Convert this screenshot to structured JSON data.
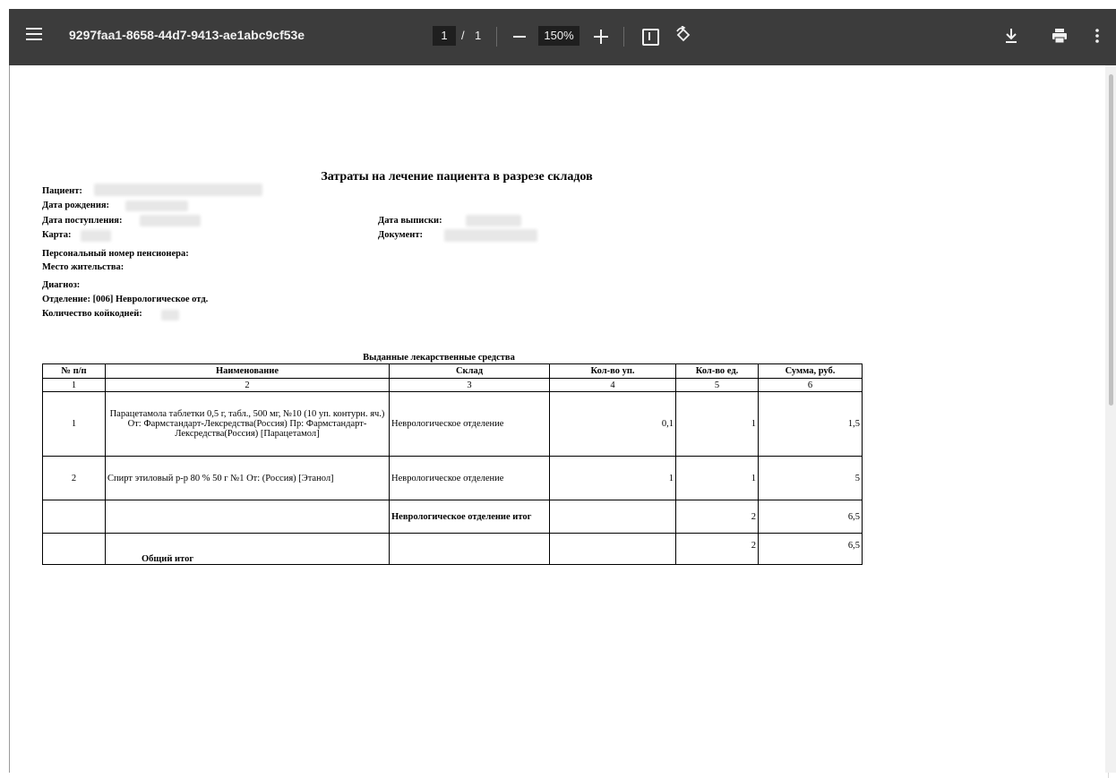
{
  "viewer": {
    "title": "9297faa1-8658-44d7-9413-ae1abc9cf53e",
    "current_page": "1",
    "page_separator": "/",
    "total_pages": "1",
    "zoom": "150%",
    "icons": {
      "menu": "menu-icon",
      "zoom_out": "minus-icon",
      "zoom_in": "plus-icon",
      "fit": "fit-page-icon",
      "rotate": "rotate-icon",
      "download": "download-icon",
      "print": "print-icon",
      "more": "more-vert-icon"
    },
    "colors": {
      "toolbar": "#3c3c3c",
      "toolbar_text": "#f1f1f1",
      "input_bg": "#1f1f1f"
    }
  },
  "document": {
    "title": "Затраты на лечение пациента в разрезе складов",
    "fields": {
      "patient": "Пациент:",
      "birth_date": "Дата рождения:",
      "admission_date": "Дата поступления:",
      "discharge_date": "Дата выписки:",
      "card": "Карта:",
      "document": "Документ:",
      "pension_number": "Персональный номер пенсионера:",
      "residence": "Место жительства:",
      "diagnosis": "Диагноз:",
      "department": "Отделение: [006] Неврологическое отд.",
      "bed_days": "Количество койкодней:"
    },
    "table": {
      "caption": "Выданные лекарственные средства",
      "headers": [
        "№ п/п",
        "Наименование",
        "Склад",
        "Кол-во уп.",
        "Кол-во ед.",
        "Сумма, руб."
      ],
      "col_numbers": [
        "1",
        "2",
        "3",
        "4",
        "5",
        "6"
      ],
      "rows": [
        {
          "num": "1",
          "name": "Парацетамола таблетки 0,5 г, табл., 500 мг, №10 (10 уп. контурн. яч.) От: Фармстандарт-Лексредства(Россия) Пр: Фармстандарт-Лексредства(Россия) [Парацетамол]",
          "warehouse": "Неврологическое отделение",
          "packs": "0,1",
          "units": "1",
          "sum": "1,5"
        },
        {
          "num": "2",
          "name": "Спирт этиловый р-р 80 %  50 г №1  От: (Россия) [Этанол]",
          "warehouse": "Неврологическое отделение",
          "packs": "1",
          "units": "1",
          "sum": "5"
        }
      ],
      "subtotal": {
        "label": "Неврологическое отделение итог",
        "units": "2",
        "sum": "6,5"
      },
      "total": {
        "label": "Общий итог",
        "units": "2",
        "sum": "6,5"
      }
    }
  }
}
